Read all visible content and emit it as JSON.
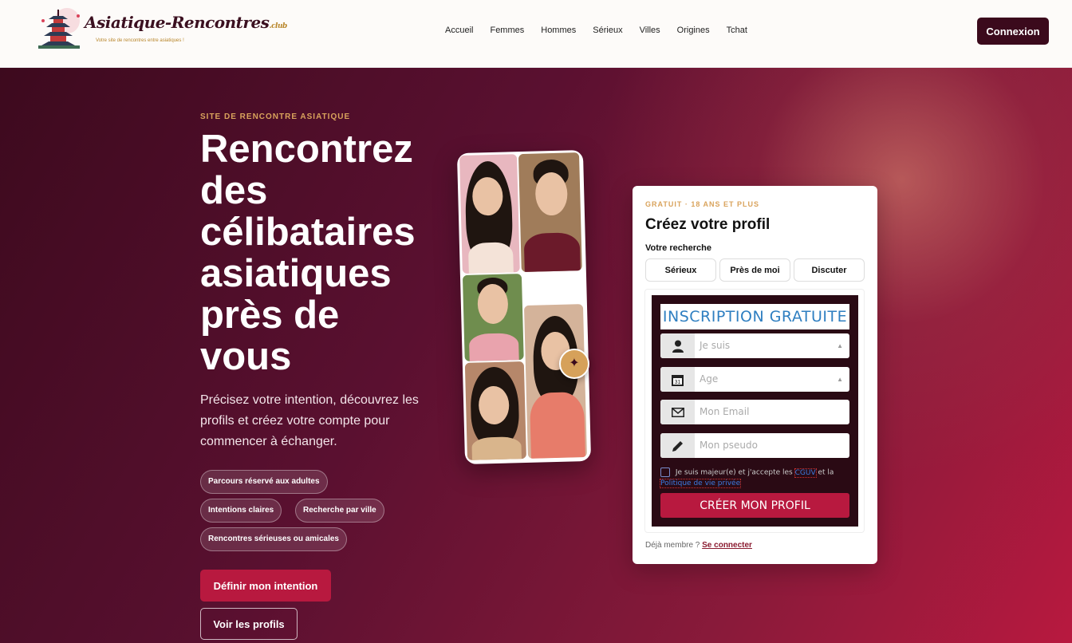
{
  "header": {
    "logo_text": "Asiatique-Rencontres",
    "logo_tld": ".club",
    "logo_tagline": "Votre site de rencontres entre asiatiques !",
    "nav": [
      "Accueil",
      "Femmes",
      "Hommes",
      "Sérieux",
      "Villes",
      "Origines",
      "Tchat"
    ],
    "login_label": "Connexion"
  },
  "hero": {
    "kicker": "SITE DE RENCONTRE ASIATIQUE",
    "headline": "Rencontrez des célibataires asiatiques près de vous",
    "lead": "Précisez votre intention, découvrez les profils et créez votre compte pour commencer à échanger.",
    "chips": [
      "Parcours réservé aux adultes",
      "Intentions claires",
      "Recherche par ville",
      "Rencontres sérieuses ou amicales"
    ],
    "primary_cta": "Définir mon intention",
    "secondary_cta": "Voir les profils"
  },
  "form_card": {
    "kicker": "GRATUIT · 18 ANS ET PLUS",
    "title": "Créez votre profil",
    "search_label": "Votre recherche",
    "intents": [
      "Sérieux",
      "Près de moi",
      "Discuter"
    ],
    "form_title": "INSCRIPTION GRATUITE",
    "gender_placeholder": "Je suis",
    "age_placeholder": "Age",
    "email_placeholder": "Mon Email",
    "pseudo_placeholder": "Mon pseudo",
    "terms_prefix": "Je suis majeur(e) et j'accepte les",
    "terms_cguv": "CGUV",
    "terms_and": "et la",
    "terms_privacy": "Politique de vie privée",
    "submit_label": "CRÉER MON PROFIL",
    "already_member": "Déjà membre ?",
    "sign_in_link": "Se connecter"
  },
  "colors": {
    "brand_dark": "#3b0a1c",
    "accent_red": "#b8193f",
    "gold": "#d9a35c"
  }
}
